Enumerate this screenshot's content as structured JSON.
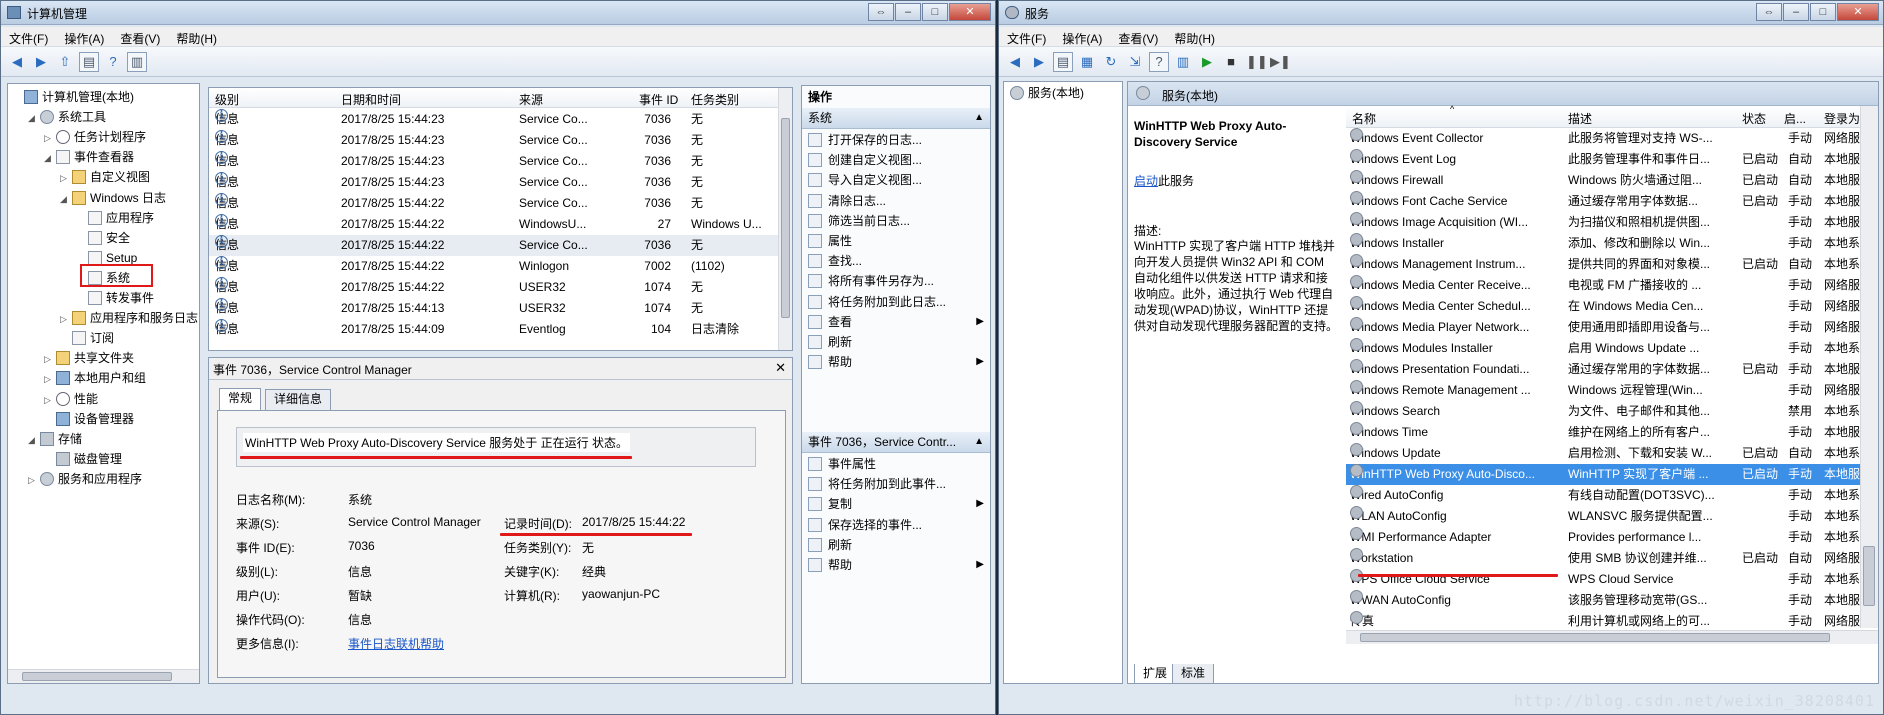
{
  "left": {
    "title": "计算机管理",
    "menu": [
      "文件(F)",
      "操作(A)",
      "查看(V)",
      "帮助(H)"
    ],
    "tree": [
      {
        "label": "计算机管理(本地)",
        "level": 0,
        "expander": "",
        "icon": "computer-icon"
      },
      {
        "label": "系统工具",
        "level": 1,
        "expander": "◢",
        "icon": "tools-icon"
      },
      {
        "label": "任务计划程序",
        "level": 2,
        "expander": "▷",
        "icon": "clock-icon"
      },
      {
        "label": "事件查看器",
        "level": 2,
        "expander": "◢",
        "icon": "event-viewer-icon"
      },
      {
        "label": "自定义视图",
        "level": 3,
        "expander": "▷",
        "icon": "folder-icon"
      },
      {
        "label": "Windows 日志",
        "level": 3,
        "expander": "◢",
        "icon": "folder-icon"
      },
      {
        "label": "应用程序",
        "level": 4,
        "expander": "",
        "icon": "log-icon"
      },
      {
        "label": "安全",
        "level": 4,
        "expander": "",
        "icon": "log-icon"
      },
      {
        "label": "Setup",
        "level": 4,
        "expander": "",
        "icon": "log-icon"
      },
      {
        "label": "系统",
        "level": 4,
        "expander": "",
        "icon": "log-icon"
      },
      {
        "label": "转发事件",
        "level": 4,
        "expander": "",
        "icon": "log-icon"
      },
      {
        "label": "应用程序和服务日志",
        "level": 3,
        "expander": "▷",
        "icon": "folder-icon"
      },
      {
        "label": "订阅",
        "level": 3,
        "expander": "",
        "icon": "subscription-icon"
      },
      {
        "label": "共享文件夹",
        "level": 2,
        "expander": "▷",
        "icon": "shared-folder-icon"
      },
      {
        "label": "本地用户和组",
        "level": 2,
        "expander": "▷",
        "icon": "users-icon"
      },
      {
        "label": "性能",
        "level": 2,
        "expander": "▷",
        "icon": "performance-icon"
      },
      {
        "label": "设备管理器",
        "level": 2,
        "expander": "",
        "icon": "device-manager-icon"
      },
      {
        "label": "存储",
        "level": 1,
        "expander": "◢",
        "icon": "storage-icon"
      },
      {
        "label": "磁盘管理",
        "level": 2,
        "expander": "",
        "icon": "disk-icon"
      },
      {
        "label": "服务和应用程序",
        "level": 1,
        "expander": "▷",
        "icon": "services-apps-icon"
      }
    ],
    "events": {
      "columns": [
        "级别",
        "日期和时间",
        "来源",
        "事件 ID",
        "任务类别"
      ],
      "rows": [
        [
          "信息",
          "2017/8/25 15:44:23",
          "Service Co...",
          "7036",
          "无"
        ],
        [
          "信息",
          "2017/8/25 15:44:23",
          "Service Co...",
          "7036",
          "无"
        ],
        [
          "信息",
          "2017/8/25 15:44:23",
          "Service Co...",
          "7036",
          "无"
        ],
        [
          "信息",
          "2017/8/25 15:44:23",
          "Service Co...",
          "7036",
          "无"
        ],
        [
          "信息",
          "2017/8/25 15:44:22",
          "Service Co...",
          "7036",
          "无"
        ],
        [
          "信息",
          "2017/8/25 15:44:22",
          "WindowsU...",
          "27",
          "Windows U..."
        ],
        [
          "信息",
          "2017/8/25 15:44:22",
          "Service Co...",
          "7036",
          "无"
        ],
        [
          "信息",
          "2017/8/25 15:44:22",
          "Winlogon",
          "7002",
          "(1102)"
        ],
        [
          "信息",
          "2017/8/25 15:44:22",
          "USER32",
          "1074",
          "无"
        ],
        [
          "信息",
          "2017/8/25 15:44:13",
          "USER32",
          "1074",
          "无"
        ],
        [
          "信息",
          "2017/8/25 15:44:09",
          "Eventlog",
          "104",
          "日志清除"
        ]
      ]
    },
    "detail": {
      "title": "事件 7036，Service Control Manager",
      "close": "✕",
      "tabs": [
        "常规",
        "详细信息"
      ],
      "message": "WinHTTP Web Proxy Auto-Discovery Service 服务处于 正在运行 状态。",
      "fields": {
        "log_name_label": "日志名称(M):",
        "log_name": "系统",
        "source_label": "来源(S):",
        "source": "Service Control Manager",
        "logged_label": "记录时间(D):",
        "logged": "2017/8/25 15:44:22",
        "event_id_label": "事件 ID(E):",
        "event_id": "7036",
        "task_label": "任务类别(Y):",
        "task": "无",
        "level_label": "级别(L):",
        "level": "信息",
        "keywords_label": "关键字(K):",
        "keywords": "经典",
        "user_label": "用户(U):",
        "user": "暂缺",
        "computer_label": "计算机(R):",
        "computer": "yaowanjun-PC",
        "opcode_label": "操作代码(O):",
        "opcode": "信息",
        "more_label": "更多信息(I):",
        "more_link": "事件日志联机帮助"
      }
    },
    "actions": {
      "header": "操作",
      "section1": "系统",
      "items1": [
        "打开保存的日志...",
        "创建自定义视图...",
        "导入自定义视图...",
        "清除日志...",
        "筛选当前日志...",
        "属性",
        "查找...",
        "将所有事件另存为...",
        "将任务附加到此日志...",
        "查看",
        "刷新",
        "帮助"
      ],
      "section2": "事件 7036，Service Contr...",
      "items2": [
        "事件属性",
        "将任务附加到此事件...",
        "复制",
        "保存选择的事件...",
        "刷新",
        "帮助"
      ]
    }
  },
  "right": {
    "title": "服务",
    "menu": [
      "文件(F)",
      "操作(A)",
      "查看(V)",
      "帮助(H)"
    ],
    "tree_item": "服务(本地)",
    "header": "服务(本地)",
    "selected_name": "WinHTTP Web Proxy Auto-Discovery Service",
    "start_link": "启动",
    "start_suffix": "此服务",
    "desc_label": "描述:",
    "description": "WinHTTP 实现了客户端 HTTP 堆栈并向开发人员提供 Win32 API 和 COM 自动化组件以供发送 HTTP 请求和接收响应。此外，通过执行 Web 代理自动发现(WPAD)协议，WinHTTP 还提供对自动发现代理服务器配置的支持。",
    "columns": [
      "名称",
      "描述",
      "状态",
      "启...",
      "登录为"
    ],
    "services": [
      [
        "Windows Event Collector",
        "此服务将管理对支持 WS-...",
        "",
        "手动",
        "网络服务"
      ],
      [
        "Windows Event Log",
        "此服务管理事件和事件日...",
        "已启动",
        "自动",
        "本地服务"
      ],
      [
        "Windows Firewall",
        "Windows 防火墙通过阻...",
        "已启动",
        "自动",
        "本地服务"
      ],
      [
        "Windows Font Cache Service",
        "通过缓存常用字体数据...",
        "已启动",
        "手动",
        "本地服务"
      ],
      [
        "Windows Image Acquisition (WI...",
        "为扫描仪和照相机提供图...",
        "",
        "手动",
        "本地服务"
      ],
      [
        "Windows Installer",
        "添加、修改和删除以 Win...",
        "",
        "手动",
        "本地系统"
      ],
      [
        "Windows Management Instrum...",
        "提供共同的界面和对象模...",
        "已启动",
        "自动",
        "本地系统"
      ],
      [
        "Windows Media Center Receive...",
        "电视或 FM 广播接收的 ...",
        "",
        "手动",
        "网络服务"
      ],
      [
        "Windows Media Center Schedul...",
        "在 Windows Media Cen...",
        "",
        "手动",
        "网络服务"
      ],
      [
        "Windows Media Player Network...",
        "使用通用即插即用设备与...",
        "",
        "手动",
        "网络服务"
      ],
      [
        "Windows Modules Installer",
        "启用 Windows Update ...",
        "",
        "手动",
        "本地系统"
      ],
      [
        "Windows Presentation Foundati...",
        "通过缓存常用的字体数据...",
        "已启动",
        "手动",
        "本地服务"
      ],
      [
        "Windows Remote Management ...",
        "Windows 远程管理(Win...",
        "",
        "手动",
        "网络服务"
      ],
      [
        "Windows Search",
        "为文件、电子邮件和其他...",
        "",
        "禁用",
        "本地系统"
      ],
      [
        "Windows Time",
        "维护在网络上的所有客户...",
        "",
        "手动",
        "本地服务"
      ],
      [
        "Windows Update",
        "启用检测、下载和安装 W...",
        "已启动",
        "自动",
        "本地系统"
      ],
      [
        "WinHTTP Web Proxy Auto-Disco...",
        "WinHTTP 实现了客户端 ...",
        "已启动",
        "手动",
        "本地服务"
      ],
      [
        "Wired AutoConfig",
        "有线自动配置(DOT3SVC)...",
        "",
        "手动",
        "本地系统"
      ],
      [
        "WLAN AutoConfig",
        "WLANSVC 服务提供配置...",
        "",
        "手动",
        "本地系统"
      ],
      [
        "WMI Performance Adapter",
        "Provides performance l...",
        "",
        "手动",
        "本地系统"
      ],
      [
        "Workstation",
        "使用 SMB 协议创建并维...",
        "已启动",
        "自动",
        "网络服务"
      ],
      [
        "WPS Office Cloud Service",
        "WPS Cloud Service",
        "",
        "手动",
        "本地系统"
      ],
      [
        "WWAN AutoConfig",
        "该服务管理移动宽带(GS...",
        "",
        "手动",
        "本地服务"
      ],
      [
        "传真",
        "利用计算机或网络上的可...",
        "",
        "手动",
        "网络服务"
      ]
    ],
    "tabs": [
      "扩展",
      "标准"
    ]
  },
  "watermark": "http://blog.csdn.net/weixin_38208401"
}
